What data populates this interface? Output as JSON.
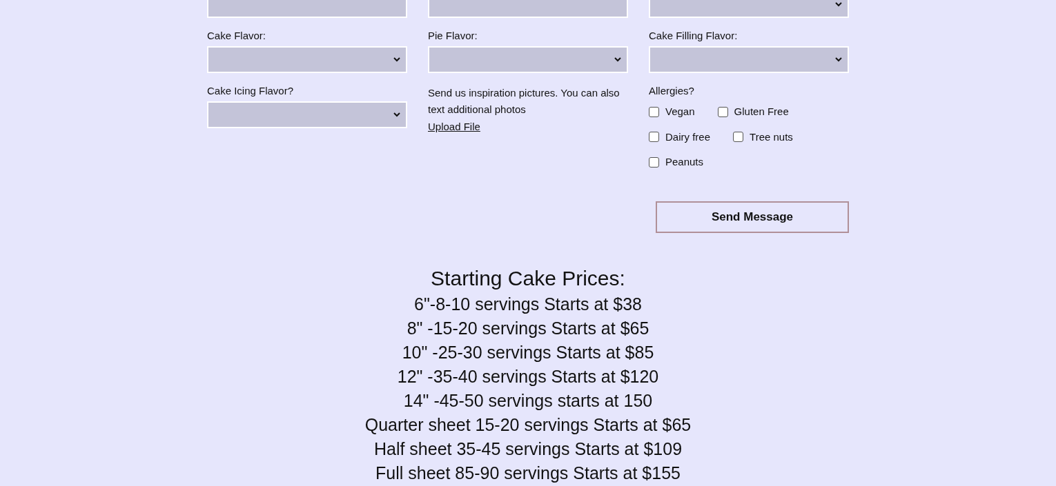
{
  "form": {
    "top_fields": [
      {
        "kind": "text"
      },
      {
        "kind": "text"
      },
      {
        "kind": "select"
      }
    ],
    "fields": [
      {
        "label": "Cake Flavor:",
        "kind": "select"
      },
      {
        "label": "Pie Flavor:",
        "kind": "select"
      },
      {
        "label": "Cake Filling Flavor:",
        "kind": "select"
      },
      {
        "label": "Cake Icing Flavor?",
        "kind": "select"
      }
    ],
    "upload": {
      "text": "Send us inspiration pictures. You can also text additional photos",
      "link": "Upload File"
    },
    "allergies": {
      "label": "Allergies?",
      "rows": [
        [
          {
            "label": "Vegan",
            "checked": false
          },
          {
            "label": "Gluten Free",
            "checked": false
          }
        ],
        [
          {
            "label": "Dairy free",
            "checked": false
          },
          {
            "label": "Tree nuts",
            "checked": false
          }
        ],
        [
          {
            "label": "Peanuts",
            "checked": false
          }
        ]
      ]
    },
    "submit": "Send Message"
  },
  "prices": {
    "title": "Starting Cake Prices:",
    "lines": [
      "6\"-8-10 servings Starts at $38",
      "8\" -15-20 servings Starts at $65",
      "10\" -25-30 servings Starts at $85",
      "12\" -35-40 servings Starts at $120",
      "14\" -45-50 servings starts at 150",
      "Quarter sheet 15-20 servings Starts at $65",
      "Half sheet 35-45 servings Starts at $109",
      "Full sheet 85-90 servings Starts at $155"
    ]
  }
}
